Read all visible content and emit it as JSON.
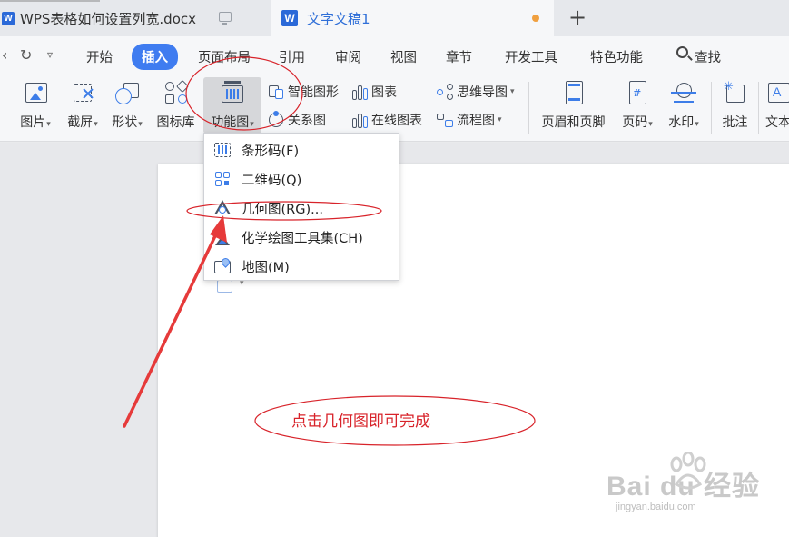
{
  "tabs": [
    {
      "label": "WPS表格如何设置列宽.docx",
      "logo": "W"
    },
    {
      "label": "文字文稿1",
      "logo": "W"
    }
  ],
  "new_tab_symbol": "+",
  "menu": {
    "items": [
      "开始",
      "插入",
      "页面布局",
      "引用",
      "审阅",
      "视图",
      "章节",
      "开发工具",
      "特色功能"
    ],
    "active": "插入",
    "search_label": "查找"
  },
  "ribbon": {
    "picture": "图片",
    "screenshot": "截屏",
    "shape": "形状",
    "icon_library": "图标库",
    "function_chart": "功能图",
    "smart_graphic": "智能图形",
    "relation_chart": "关系图",
    "chart": "图表",
    "online_chart": "在线图表",
    "mind_map": "思维导图",
    "flowchart": "流程图",
    "header_footer": "页眉和页脚",
    "page_number": "页码",
    "watermark": "水印",
    "comment": "批注",
    "text": "文本"
  },
  "dropdown": {
    "items": [
      {
        "label": "条形码(F)",
        "icon": "barcode-icon"
      },
      {
        "label": "二维码(Q)",
        "icon": "qrcode-icon"
      },
      {
        "label": "几何图(RG)...",
        "icon": "geometry-icon"
      },
      {
        "label": "化学绘图工具集(CH)",
        "icon": "chemistry-flask-icon"
      },
      {
        "label": "地图(M)",
        "icon": "map-icon"
      }
    ]
  },
  "annotation": {
    "note": "点击几何图即可完成",
    "color": "#d8232a"
  },
  "watermark": {
    "brand": "Bai du 经验",
    "url": "jingyan.baidu.com"
  },
  "colors": {
    "accent": "#3f7cf0",
    "annotation_red": "#d8232a"
  }
}
